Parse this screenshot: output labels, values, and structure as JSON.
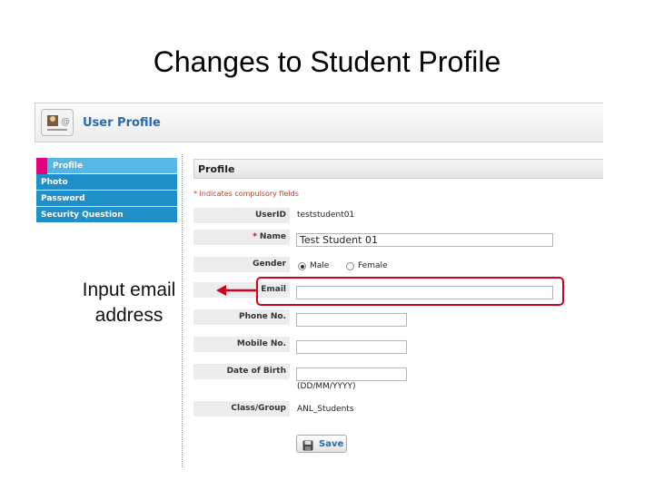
{
  "slide": {
    "title": "Changes to Student Profile",
    "callout": "Input email address"
  },
  "header": {
    "title": "User Profile",
    "icon": "user-card-icon"
  },
  "sidebar": {
    "items": [
      {
        "label": "Profile",
        "active": true
      },
      {
        "label": "Photo",
        "active": false
      },
      {
        "label": "Password",
        "active": false
      },
      {
        "label": "Security Question",
        "active": false
      }
    ]
  },
  "form": {
    "title": "Profile",
    "required_note": "* Indicates compulsory fields",
    "userid": {
      "label": "UserID",
      "value": "teststudent01"
    },
    "name": {
      "label": "Name",
      "required_mark": "*",
      "value": "Test Student 01"
    },
    "gender": {
      "label": "Gender",
      "options": [
        "Male",
        "Female"
      ],
      "selected": "Male"
    },
    "email": {
      "label": "Email",
      "value": ""
    },
    "phone": {
      "label": "Phone No.",
      "value": ""
    },
    "mobile": {
      "label": "Mobile No.",
      "value": ""
    },
    "dob": {
      "label": "Date of Birth",
      "value": "",
      "hint": "(DD/MM/YYYY)"
    },
    "class_group": {
      "label": "Class/Group",
      "value": "ANL_Students"
    },
    "save_label": "Save"
  },
  "colors": {
    "highlight": "#d0021b",
    "sidebar_bg": "#1e8fc8",
    "sidebar_active": "#56b6e4",
    "active_marker": "#e6007e",
    "header_title": "#2a6aa8"
  }
}
